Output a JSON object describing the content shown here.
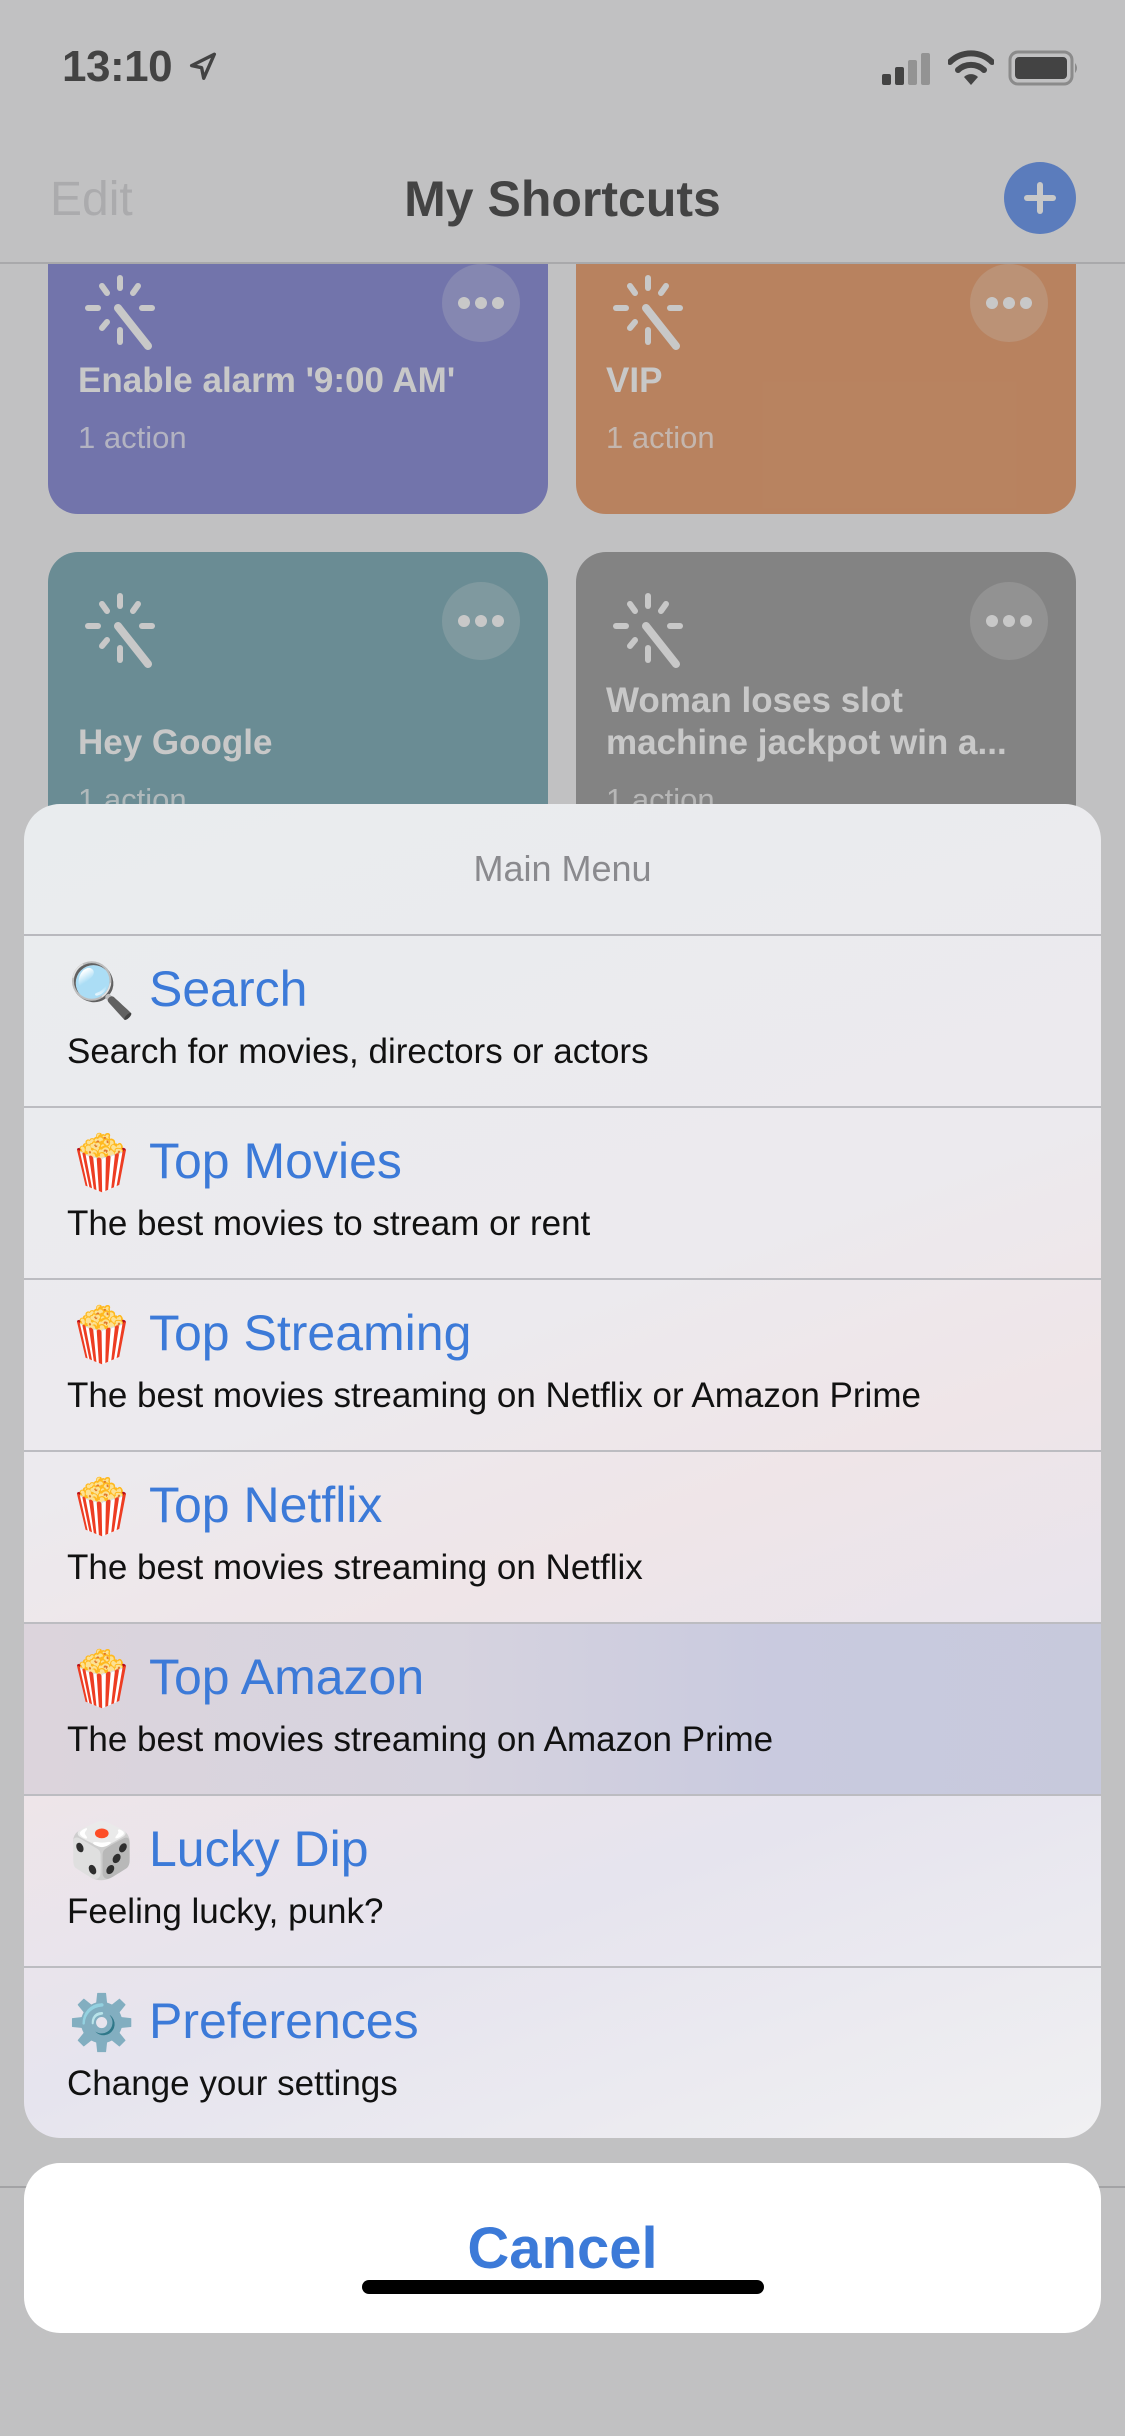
{
  "status_bar": {
    "time": "13:10",
    "location_icon": "location-arrow-icon",
    "signal_icon": "cellular-signal-icon",
    "signal_bars_filled": 2,
    "signal_bars_total": 4,
    "wifi_icon": "wifi-icon",
    "battery_icon": "battery-icon"
  },
  "nav": {
    "edit_label": "Edit",
    "title": "My Shortcuts",
    "add_icon": "plus-icon"
  },
  "shortcuts": [
    {
      "title": "Enable alarm '9:00 AM'",
      "subtitle": "1 action",
      "color": "#5b5fc7",
      "icon": "magic-wand-icon"
    },
    {
      "title": "VIP",
      "subtitle": "1 action",
      "color": "#e07a37",
      "icon": "magic-wand-icon"
    },
    {
      "title": "Hey Google",
      "subtitle": "1 action",
      "color": "#4c8d9b",
      "icon": "magic-wand-icon"
    },
    {
      "title": "Woman loses slot machine jackpot win a...",
      "subtitle": "1 action",
      "color": "#7b7b7b",
      "icon": "magic-wand-icon"
    }
  ],
  "action_sheet": {
    "title": "Main Menu",
    "items": [
      {
        "emoji": "🔍",
        "icon": "magnifying-glass-icon",
        "label": "Search",
        "description": "Search for movies, directors or actors"
      },
      {
        "emoji": "🍿",
        "icon": "popcorn-icon",
        "label": "Top Movies",
        "description": "The best movies to stream or rent"
      },
      {
        "emoji": "🍿",
        "icon": "popcorn-icon",
        "label": "Top Streaming",
        "description": "The best movies streaming on Netflix or Amazon Prime"
      },
      {
        "emoji": "🍿",
        "icon": "popcorn-icon",
        "label": "Top Netflix",
        "description": "The best movies streaming on Netflix"
      },
      {
        "emoji": "🍿",
        "icon": "popcorn-icon",
        "label": "Top Amazon",
        "description": "The best movies streaming on Amazon Prime",
        "highlighted": true
      },
      {
        "emoji": "🎲",
        "icon": "dice-icon",
        "label": "Lucky Dip",
        "description": "Feeling lucky, punk?"
      },
      {
        "emoji": "⚙️",
        "icon": "gear-icon",
        "label": "Preferences",
        "description": "Change your settings"
      }
    ],
    "cancel_label": "Cancel"
  },
  "colors": {
    "accent": "#3c7ad8",
    "add_button": "#2f6ee8"
  }
}
